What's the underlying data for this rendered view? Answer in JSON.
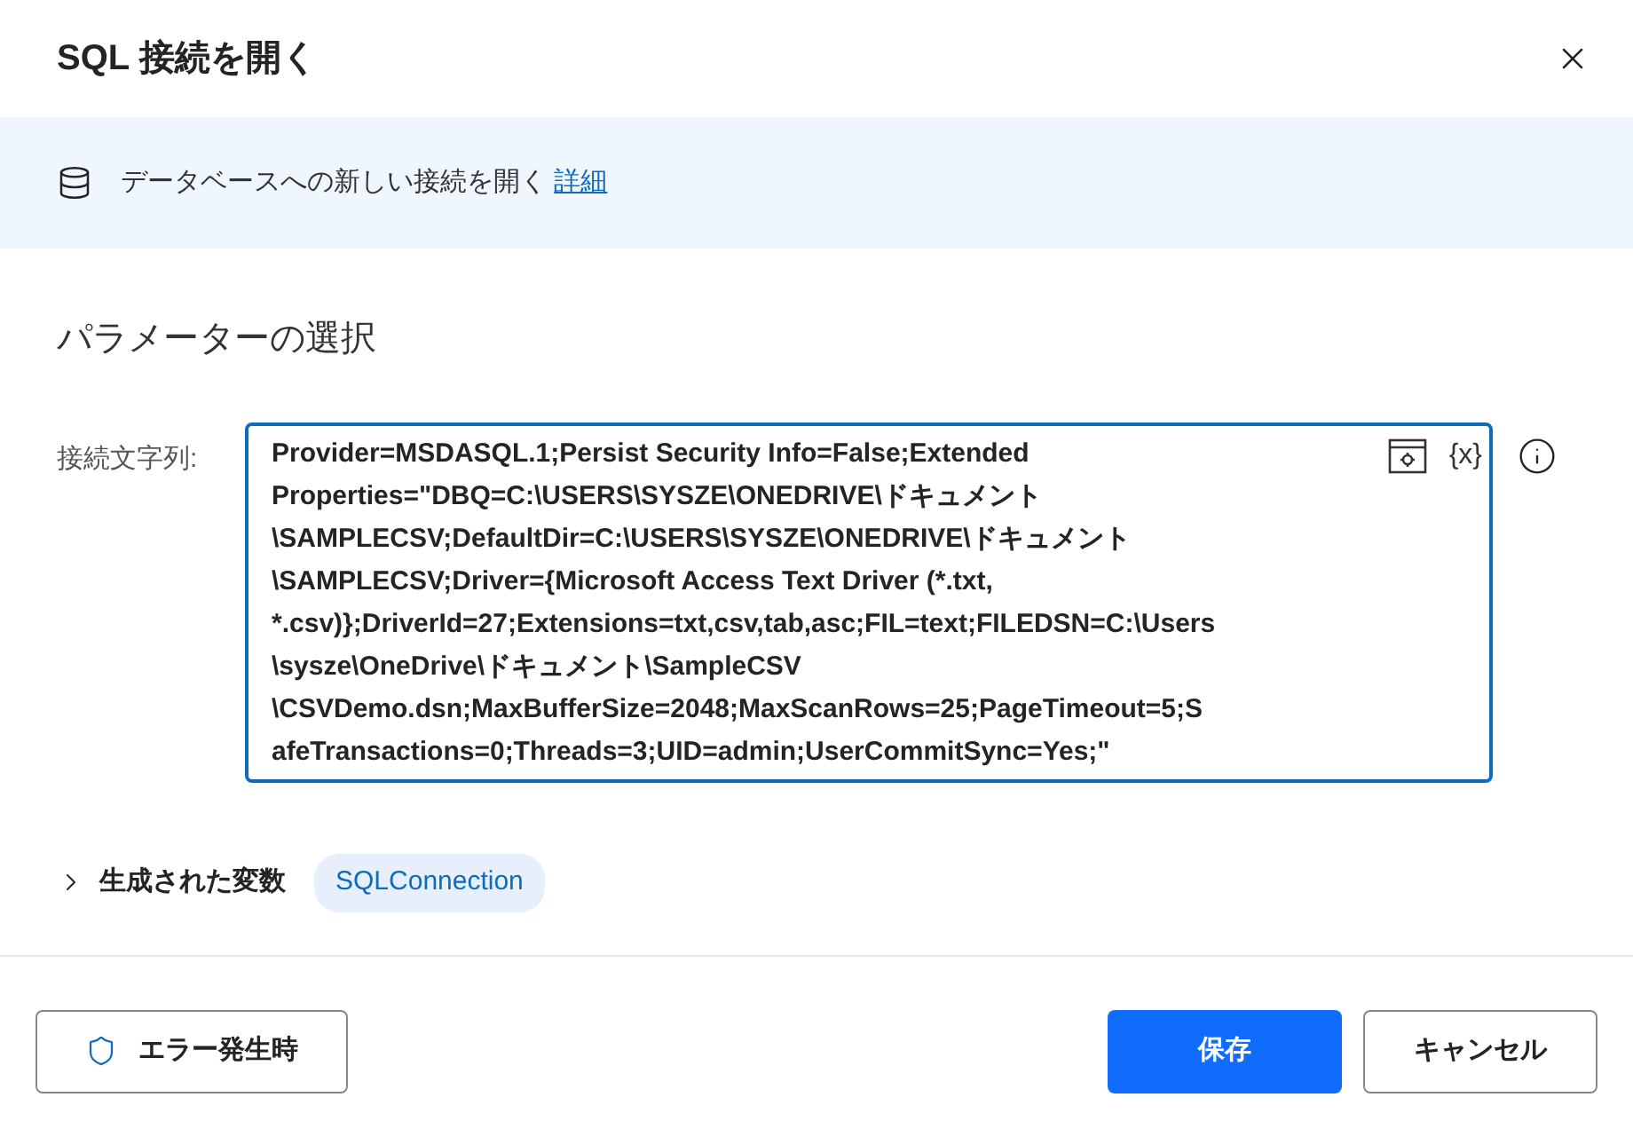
{
  "dialog": {
    "title": "SQL 接続を開く"
  },
  "info_banner": {
    "text": "データベースへの新しい接続を開く",
    "link": "詳細"
  },
  "section_title": "パラメーターの選択",
  "connection_string": {
    "label": "接続文字列:",
    "value_lines": [
      "Provider=MSDASQL.1;Persist Security Info=False;Extended",
      "Properties=\"DBQ=C:\\USERS\\SYSZE\\ONEDRIVE\\ドキュメント",
      "\\SAMPLECSV;DefaultDir=C:\\USERS\\SYSZE\\ONEDRIVE\\ドキュメント",
      "\\SAMPLECSV;Driver={Microsoft Access Text Driver (*.txt,",
      "*.csv)};DriverId=27;Extensions=txt,csv,tab,asc;FIL=text;FILEDSN=C:\\Users",
      "\\sysze\\OneDrive\\ドキュメント\\SampleCSV",
      "\\CSVDemo.dsn;MaxBufferSize=2048;MaxScanRows=25;PageTimeout=5;S",
      "afeTransactions=0;Threads=3;UID=admin;UserCommitSync=Yes;\""
    ],
    "variable_button": "{x}",
    "focused": true
  },
  "generated_variables": {
    "label": "生成された変数",
    "expanded": false,
    "variables": [
      "SQLConnection"
    ]
  },
  "footer": {
    "error_button": "エラー発生時",
    "save_button": "保存",
    "cancel_button": "キャンセル"
  }
}
